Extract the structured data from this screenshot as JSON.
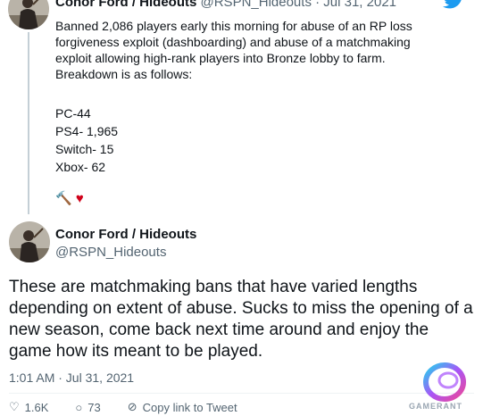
{
  "parent_tweet": {
    "display_name": "Conor Ford / Hideouts",
    "handle_date": "@RSPN_Hideouts · Jul 31, 2021",
    "text_lines": [
      "Banned 2,086 players early this morning for abuse of an RP loss",
      "forgiveness exploit (dashboarding) and abuse of a matchmaking",
      "exploit allowing high-rank players into Bronze lobby to farm.",
      "Breakdown is as follows:"
    ],
    "breakdown": [
      "PC-44",
      "PS4- 1,965",
      "Switch- 15",
      "Xbox- 62"
    ],
    "emoji": [
      "🔨",
      "♥"
    ]
  },
  "main_tweet": {
    "display_name": "Conor Ford / Hideouts",
    "handle": "@RSPN_Hideouts",
    "text": "These are matchmaking bans that have varied lengths depending on extent of abuse. Sucks to miss the opening of a new season, come back next time around and enjoy the game how its meant to be played.",
    "timestamp": "1:01 AM · Jul 31, 2021"
  },
  "actions": {
    "like_count": "1.6K",
    "reply_count": "73",
    "share_label": "Copy link to Tweet"
  },
  "watermark": {
    "text": "GAMERANT"
  },
  "colors": {
    "twitter_blue": "#1d9bf0",
    "secondary_text": "#536471"
  }
}
